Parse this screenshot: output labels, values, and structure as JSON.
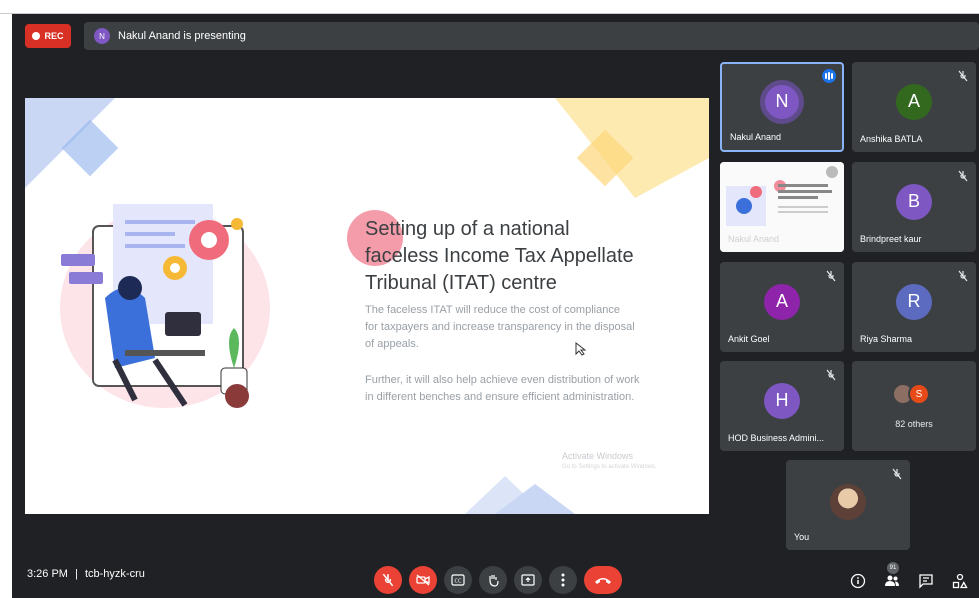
{
  "recording": {
    "label": "REC"
  },
  "presenter": {
    "initial": "N",
    "text": "Nakul Anand is presenting"
  },
  "slide": {
    "title_lines": [
      "Setting up of a national",
      "faceless Income Tax Appellate",
      "Tribunal (ITAT) centre"
    ],
    "para1_lines": [
      "The faceless ITAT will reduce the cost of compliance",
      "for taxpayers and increase transparency in the disposal",
      "of appeals."
    ],
    "para2_lines": [
      "Further, it will also help achieve even distribution of work",
      "in different benches and ensure efficient administration."
    ],
    "watermark_title": "Activate Windows",
    "watermark_sub": "Go to Settings to activate Windows."
  },
  "participants": [
    {
      "initial": "N",
      "name": "Nakul Anand",
      "color": "#7e57c2",
      "speaking": true
    },
    {
      "initial": "A",
      "name": "Anshika BATLA",
      "color": "#33691e",
      "muted": true
    },
    {
      "name": "Nakul Anand",
      "presentation_thumb": true
    },
    {
      "initial": "B",
      "name": "Brindpreet kaur",
      "color": "#7e57c2",
      "muted": true
    },
    {
      "initial": "A",
      "name": "Ankit Goel",
      "color": "#8e24aa",
      "muted": true
    },
    {
      "initial": "R",
      "name": "Riya Sharma",
      "color": "#5c6bc0",
      "muted": true
    },
    {
      "initial": "H",
      "name": "HOD Business Admini...",
      "color": "#7e57c2",
      "muted": true
    },
    {
      "others_label": "82 others",
      "others_initial": "S",
      "others_color": "#e64a19"
    },
    {
      "name": "You",
      "self": true,
      "muted": true
    }
  ],
  "meeting": {
    "time": "3:26 PM",
    "separator": "|",
    "code": "tcb-hyzk-cru"
  },
  "controls": [
    "mic-off-icon",
    "camera-off-icon",
    "captions-icon",
    "raise-hand-icon",
    "present-icon",
    "more-options-icon",
    "end-call-icon"
  ],
  "right_controls": {
    "people_badge": "91"
  },
  "colors": {
    "bg": "#202124",
    "tile": "#3c4043",
    "red": "#ea4335",
    "accent": "#8ab4f8"
  }
}
